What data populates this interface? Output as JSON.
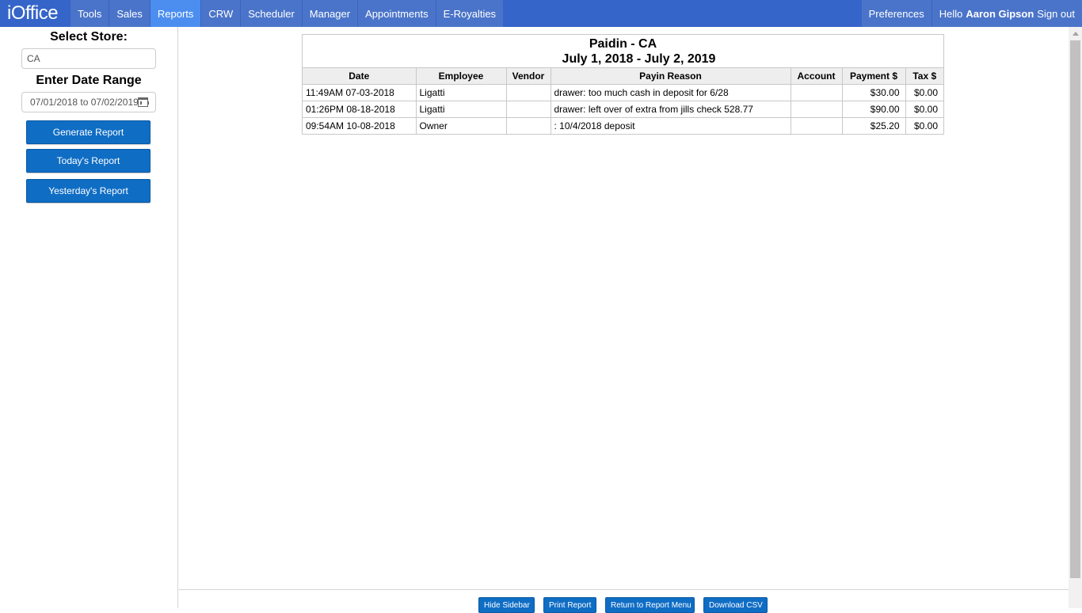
{
  "navbar": {
    "brand": "iOffice",
    "items": [
      {
        "label": "Tools",
        "active": false
      },
      {
        "label": "Sales",
        "active": false
      },
      {
        "label": "Reports",
        "active": true
      },
      {
        "label": "CRW",
        "active": false
      },
      {
        "label": "Scheduler",
        "active": false
      },
      {
        "label": "Manager",
        "active": false
      },
      {
        "label": "Appointments",
        "active": false
      },
      {
        "label": "E-Royalties",
        "active": false
      }
    ],
    "preferences": "Preferences",
    "hello": "Hello",
    "user_name": "Aaron Gipson",
    "sign_out": "Sign out"
  },
  "sidebar": {
    "store_heading": "Select Store:",
    "store_value": "CA",
    "date_heading": "Enter Date Range",
    "date_value": "07/01/2018 to 07/02/2019",
    "generate_label": "Generate Report",
    "today_label": "Today's Report",
    "yesterday_label": "Yesterday's Report"
  },
  "report": {
    "title": "Paidin - CA",
    "date_range": "July 1, 2018 - July 2, 2019",
    "columns": [
      "Date",
      "Employee",
      "Vendor",
      "Payin Reason",
      "Account",
      "Payment $",
      "Tax $"
    ],
    "rows": [
      [
        "11:49AM 07-03-2018",
        "Ligatti",
        "",
        "drawer: too much cash in deposit for 6/28",
        "",
        "$30.00",
        "$0.00"
      ],
      [
        "01:26PM 08-18-2018",
        "Ligatti",
        "",
        "drawer: left over of extra from jills check 528.77",
        "",
        "$90.00",
        "$0.00"
      ],
      [
        "09:54AM 10-08-2018",
        "Owner",
        "",
        ": 10/4/2018 deposit",
        "",
        "$25.20",
        "$0.00"
      ]
    ]
  },
  "footer": {
    "hide_sidebar": "Hide Sidebar",
    "print_report": "Print Report",
    "return_menu": "Return to Report Menu",
    "download_csv": "Download CSV"
  },
  "colors": {
    "navbar": "#3565c9",
    "active_tab": "#4b8ef0",
    "button": "#0f6dc4"
  }
}
